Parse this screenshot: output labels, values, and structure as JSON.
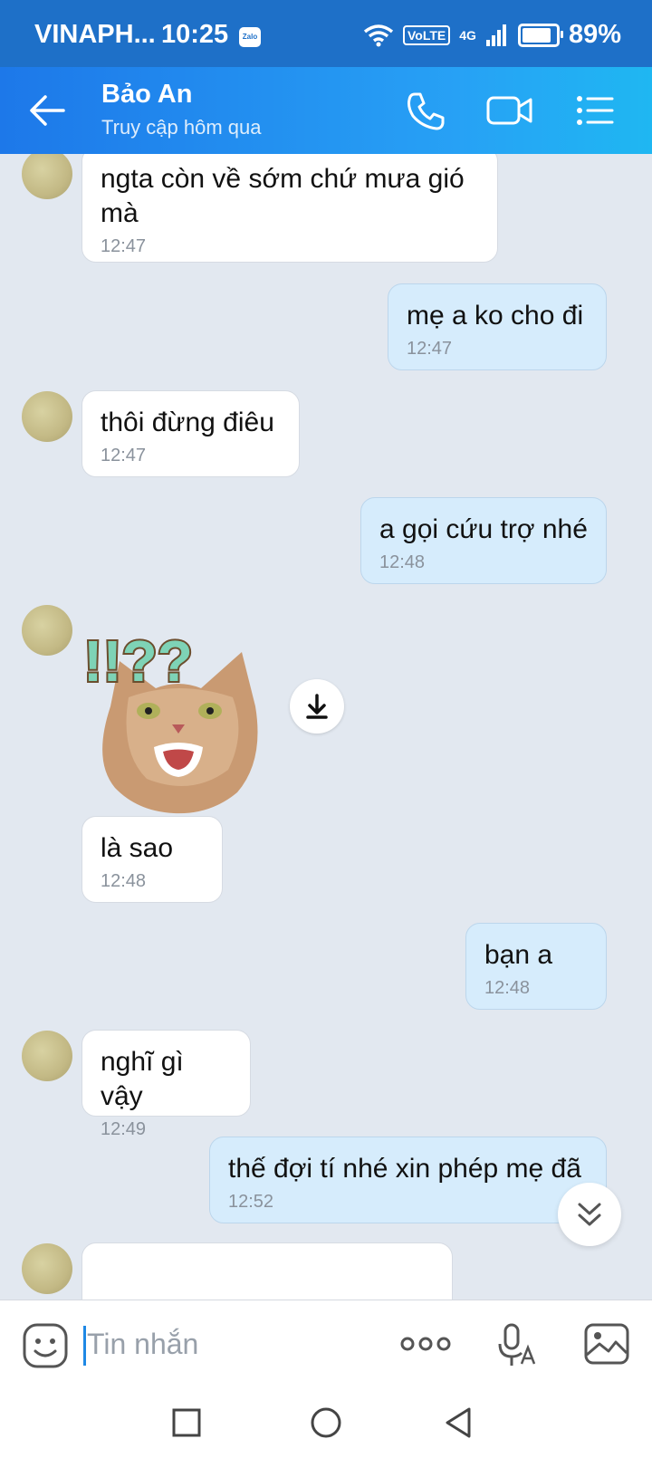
{
  "status_bar": {
    "carrier": "VINAPH...",
    "time": "10:25",
    "app_badge": "Zalo",
    "volte": "VoLTE",
    "network": "4G",
    "battery": "89%"
  },
  "header": {
    "contact_name": "Bảo An",
    "last_seen": "Truy cập hôm qua"
  },
  "messages": [
    {
      "side": "in",
      "text": "ngta còn về sớm chứ mưa gió\nmà",
      "time": "12:47"
    },
    {
      "side": "out",
      "text": "mẹ a ko cho đi",
      "time": "12:47"
    },
    {
      "side": "in",
      "text": "thôi đừng điêu",
      "time": "12:47"
    },
    {
      "side": "out",
      "text": "a gọi cứu trợ nhé",
      "time": "12:48"
    },
    {
      "side": "in",
      "type": "sticker",
      "caption": "!!??"
    },
    {
      "side": "in",
      "text": "là sao",
      "time": "12:48"
    },
    {
      "side": "out",
      "text": "bạn a",
      "time": "12:48"
    },
    {
      "side": "in",
      "text": "nghĩ gì vậy",
      "time": "12:49"
    },
    {
      "side": "out",
      "text": "thế đợi tí nhé xin phép mẹ đã",
      "time": "12:52"
    }
  ],
  "input": {
    "placeholder": "Tin nhắn"
  },
  "colors": {
    "header_start": "#1d78e9",
    "header_end": "#1fb7f2",
    "outgoing_bubble": "#d6ecfc",
    "incoming_bubble": "#ffffff",
    "chat_bg": "#e2e8f0"
  },
  "icons": [
    "back-arrow-icon",
    "phone-icon",
    "video-call-icon",
    "menu-list-icon",
    "download-icon",
    "chevron-double-down-icon",
    "emoji-icon",
    "more-icon",
    "voice-text-icon",
    "image-icon"
  ]
}
